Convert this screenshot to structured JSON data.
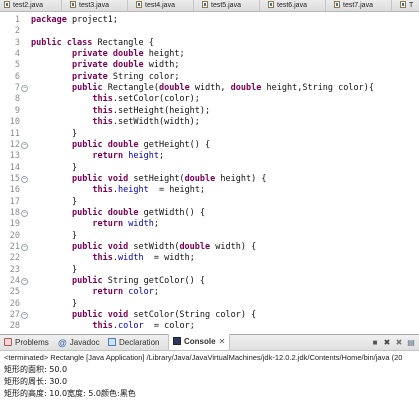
{
  "tabs": [
    "test2.java",
    "test3.java",
    "test4.java",
    "test5.java",
    "test6.java",
    "test7.java",
    "T"
  ],
  "code_lines": [
    {
      "n": "1",
      "fold": "",
      "segs": [
        [
          "kw",
          "package"
        ],
        [
          "",
          "project1;"
        ]
      ]
    },
    {
      "n": "2",
      "fold": "",
      "segs": []
    },
    {
      "n": "3",
      "fold": "",
      "segs": [
        [
          "kw",
          "public class"
        ],
        [
          "",
          "Rectangle {"
        ]
      ]
    },
    {
      "n": "4",
      "fold": "",
      "segs": [
        [
          "",
          "        "
        ],
        [
          "kw",
          "private double"
        ],
        [
          "",
          "height;"
        ]
      ]
    },
    {
      "n": "5",
      "fold": "",
      "segs": [
        [
          "",
          "        "
        ],
        [
          "kw",
          "private double"
        ],
        [
          "",
          "width;"
        ]
      ]
    },
    {
      "n": "6",
      "fold": "",
      "segs": [
        [
          "",
          "        "
        ],
        [
          "kw",
          "private"
        ],
        [
          "",
          "String color;"
        ]
      ]
    },
    {
      "n": "7",
      "fold": "−",
      "segs": [
        [
          "",
          "        "
        ],
        [
          "kw",
          "public"
        ],
        [
          "",
          "Rectangle("
        ],
        [
          "kw",
          "double"
        ],
        [
          "",
          "width,"
        ],
        [
          "kw",
          "double"
        ],
        [
          "",
          "height,String color){"
        ]
      ]
    },
    {
      "n": "8",
      "fold": "",
      "segs": [
        [
          "",
          "            "
        ],
        [
          "kw",
          "this"
        ],
        [
          "",
          ".setColor(color);"
        ]
      ]
    },
    {
      "n": "9",
      "fold": "",
      "segs": [
        [
          "",
          "            "
        ],
        [
          "kw",
          "this"
        ],
        [
          "",
          ".setHeight(height);"
        ]
      ]
    },
    {
      "n": "10",
      "fold": "",
      "segs": [
        [
          "",
          "            "
        ],
        [
          "kw",
          "this"
        ],
        [
          "",
          ".setWidth(width);"
        ]
      ]
    },
    {
      "n": "11",
      "fold": "",
      "segs": [
        [
          "",
          "        }"
        ]
      ]
    },
    {
      "n": "12",
      "fold": "−",
      "segs": [
        [
          "",
          "        "
        ],
        [
          "kw",
          "public double"
        ],
        [
          "",
          "getHeight() {"
        ]
      ]
    },
    {
      "n": "13",
      "fold": "",
      "segs": [
        [
          "",
          "            "
        ],
        [
          "kw",
          "return"
        ],
        [
          "fd",
          "height"
        ],
        [
          "",
          ";"
        ]
      ]
    },
    {
      "n": "14",
      "fold": "",
      "segs": [
        [
          "",
          "        }"
        ]
      ]
    },
    {
      "n": "15",
      "fold": "−",
      "segs": [
        [
          "",
          "        "
        ],
        [
          "kw",
          "public void"
        ],
        [
          "",
          "setHeight("
        ],
        [
          "kw",
          "double"
        ],
        [
          "",
          "height) {"
        ]
      ]
    },
    {
      "n": "16",
      "fold": "",
      "segs": [
        [
          "",
          "            "
        ],
        [
          "kw",
          "this"
        ],
        [
          "",
          "."
        ],
        [
          "fd",
          "height"
        ],
        [
          "",
          " = height;"
        ]
      ]
    },
    {
      "n": "17",
      "fold": "",
      "segs": [
        [
          "",
          "        }"
        ]
      ]
    },
    {
      "n": "18",
      "fold": "−",
      "segs": [
        [
          "",
          "        "
        ],
        [
          "kw",
          "public double"
        ],
        [
          "",
          "getWidth() {"
        ]
      ]
    },
    {
      "n": "19",
      "fold": "",
      "segs": [
        [
          "",
          "            "
        ],
        [
          "kw",
          "return"
        ],
        [
          "fd",
          "width"
        ],
        [
          "",
          ";"
        ]
      ]
    },
    {
      "n": "20",
      "fold": "",
      "segs": [
        [
          "",
          "        }"
        ]
      ]
    },
    {
      "n": "21",
      "fold": "−",
      "segs": [
        [
          "",
          "        "
        ],
        [
          "kw",
          "public void"
        ],
        [
          "",
          "setWidth("
        ],
        [
          "kw",
          "double"
        ],
        [
          "",
          "width) {"
        ]
      ]
    },
    {
      "n": "22",
      "fold": "",
      "segs": [
        [
          "",
          "            "
        ],
        [
          "kw",
          "this"
        ],
        [
          "",
          "."
        ],
        [
          "fd",
          "width"
        ],
        [
          "",
          " = width;"
        ]
      ]
    },
    {
      "n": "23",
      "fold": "",
      "segs": [
        [
          "",
          "        }"
        ]
      ]
    },
    {
      "n": "24",
      "fold": "−",
      "segs": [
        [
          "",
          "        "
        ],
        [
          "kw",
          "public"
        ],
        [
          "",
          "String getColor() {"
        ]
      ]
    },
    {
      "n": "25",
      "fold": "",
      "segs": [
        [
          "",
          "            "
        ],
        [
          "kw",
          "return"
        ],
        [
          "fd",
          "color"
        ],
        [
          "",
          ";"
        ]
      ]
    },
    {
      "n": "26",
      "fold": "",
      "segs": [
        [
          "",
          "        }"
        ]
      ]
    },
    {
      "n": "27",
      "fold": "−",
      "segs": [
        [
          "",
          "        "
        ],
        [
          "kw",
          "public void"
        ],
        [
          "",
          "setColor(String color) {"
        ]
      ]
    },
    {
      "n": "28",
      "fold": "",
      "segs": [
        [
          "",
          "            "
        ],
        [
          "kw",
          "this"
        ],
        [
          "",
          "."
        ],
        [
          "fd",
          "color"
        ],
        [
          "",
          " = color;"
        ]
      ]
    }
  ],
  "console": {
    "tabs": {
      "problems": "Problems",
      "javadoc": "Javadoc",
      "declaration": "Declaration",
      "console": "Console"
    },
    "status": "<terminated> Rectangle [Java Application] /Library/Java/JavaVirtualMachines/jdk-12.0.2.jdk/Contents/Home/bin/java (20",
    "output": [
      "矩形的面积: 50.0",
      "矩形的周长: 30.0",
      "矩形的高度: 10.0宽度: 5.0颜色:黑色"
    ]
  },
  "colors": {
    "keyword": "#7f0055",
    "field": "#0000c0",
    "line_number": "#8c8c8c"
  }
}
